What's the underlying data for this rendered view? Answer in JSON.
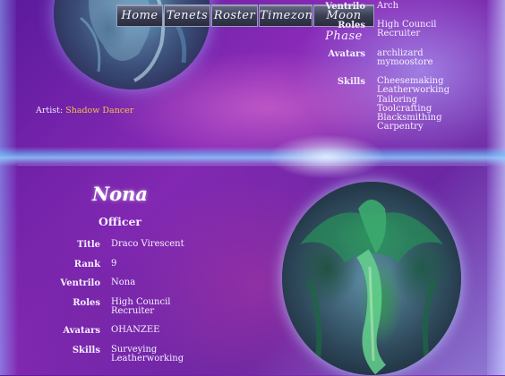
{
  "nav": {
    "items": [
      {
        "label": "Home"
      },
      {
        "label": "Tenets"
      },
      {
        "label": "Roster"
      },
      {
        "label": "Timezones"
      },
      {
        "label": "Moon Phase"
      }
    ]
  },
  "top_member": {
    "artist_label": "Artist:",
    "artist_name": "Shadow Dancer",
    "fields": {
      "ventrilo_label": "Ventrilo",
      "ventrilo_value": "Arch",
      "roles_label": "Roles",
      "roles_value": [
        "High Council",
        "Recruiter"
      ],
      "avatars_label": "Avatars",
      "avatars_value": [
        "archlizard",
        "mymoostore"
      ],
      "skills_label": "Skills",
      "skills_value": [
        "Cheesemaking",
        "Leatherworking",
        "Tailoring",
        "Toolcrafting",
        "Blacksmithing",
        "Carpentry"
      ]
    }
  },
  "member": {
    "name": "Nona",
    "rank_title": "Officer",
    "title_label": "Title",
    "title_value": "Draco Virescent",
    "rank_label": "Rank",
    "rank_value": "9",
    "ventrilo_label": "Ventrilo",
    "ventrilo_value": "Nona",
    "roles_label": "Roles",
    "roles_value": [
      "High Council",
      "Recruiter"
    ],
    "avatars_label": "Avatars",
    "avatars_value": "OHANZEE",
    "skills_label": "Skills",
    "skills_value": [
      "Surveying",
      "Leatherworking"
    ]
  },
  "colors": {
    "artist_name": "#f2c24a",
    "text": "#f6f0ff",
    "nav_bg": "#3b3e54",
    "band": "#6ec8ff"
  },
  "icons": {
    "top_art": "blue-dragon-art",
    "bottom_art": "green-dragon-art"
  }
}
